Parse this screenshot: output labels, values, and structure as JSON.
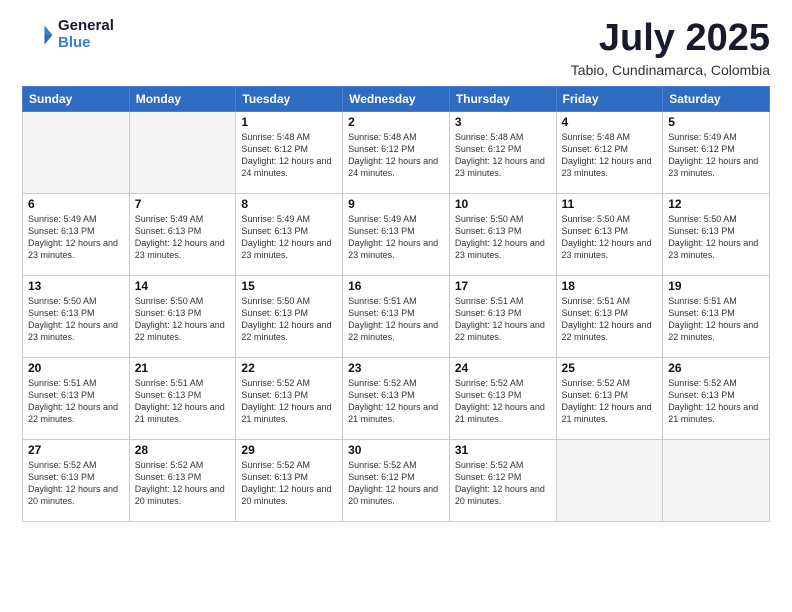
{
  "logo": {
    "general": "General",
    "blue": "Blue"
  },
  "header": {
    "month": "July 2025",
    "location": "Tabio, Cundinamarca, Colombia"
  },
  "weekdays": [
    "Sunday",
    "Monday",
    "Tuesday",
    "Wednesday",
    "Thursday",
    "Friday",
    "Saturday"
  ],
  "weeks": [
    [
      {
        "day": "",
        "info": ""
      },
      {
        "day": "",
        "info": ""
      },
      {
        "day": "1",
        "info": "Sunrise: 5:48 AM\nSunset: 6:12 PM\nDaylight: 12 hours and 24 minutes."
      },
      {
        "day": "2",
        "info": "Sunrise: 5:48 AM\nSunset: 6:12 PM\nDaylight: 12 hours and 24 minutes."
      },
      {
        "day": "3",
        "info": "Sunrise: 5:48 AM\nSunset: 6:12 PM\nDaylight: 12 hours and 23 minutes."
      },
      {
        "day": "4",
        "info": "Sunrise: 5:48 AM\nSunset: 6:12 PM\nDaylight: 12 hours and 23 minutes."
      },
      {
        "day": "5",
        "info": "Sunrise: 5:49 AM\nSunset: 6:12 PM\nDaylight: 12 hours and 23 minutes."
      }
    ],
    [
      {
        "day": "6",
        "info": "Sunrise: 5:49 AM\nSunset: 6:13 PM\nDaylight: 12 hours and 23 minutes."
      },
      {
        "day": "7",
        "info": "Sunrise: 5:49 AM\nSunset: 6:13 PM\nDaylight: 12 hours and 23 minutes."
      },
      {
        "day": "8",
        "info": "Sunrise: 5:49 AM\nSunset: 6:13 PM\nDaylight: 12 hours and 23 minutes."
      },
      {
        "day": "9",
        "info": "Sunrise: 5:49 AM\nSunset: 6:13 PM\nDaylight: 12 hours and 23 minutes."
      },
      {
        "day": "10",
        "info": "Sunrise: 5:50 AM\nSunset: 6:13 PM\nDaylight: 12 hours and 23 minutes."
      },
      {
        "day": "11",
        "info": "Sunrise: 5:50 AM\nSunset: 6:13 PM\nDaylight: 12 hours and 23 minutes."
      },
      {
        "day": "12",
        "info": "Sunrise: 5:50 AM\nSunset: 6:13 PM\nDaylight: 12 hours and 23 minutes."
      }
    ],
    [
      {
        "day": "13",
        "info": "Sunrise: 5:50 AM\nSunset: 6:13 PM\nDaylight: 12 hours and 23 minutes."
      },
      {
        "day": "14",
        "info": "Sunrise: 5:50 AM\nSunset: 6:13 PM\nDaylight: 12 hours and 22 minutes."
      },
      {
        "day": "15",
        "info": "Sunrise: 5:50 AM\nSunset: 6:13 PM\nDaylight: 12 hours and 22 minutes."
      },
      {
        "day": "16",
        "info": "Sunrise: 5:51 AM\nSunset: 6:13 PM\nDaylight: 12 hours and 22 minutes."
      },
      {
        "day": "17",
        "info": "Sunrise: 5:51 AM\nSunset: 6:13 PM\nDaylight: 12 hours and 22 minutes."
      },
      {
        "day": "18",
        "info": "Sunrise: 5:51 AM\nSunset: 6:13 PM\nDaylight: 12 hours and 22 minutes."
      },
      {
        "day": "19",
        "info": "Sunrise: 5:51 AM\nSunset: 6:13 PM\nDaylight: 12 hours and 22 minutes."
      }
    ],
    [
      {
        "day": "20",
        "info": "Sunrise: 5:51 AM\nSunset: 6:13 PM\nDaylight: 12 hours and 22 minutes."
      },
      {
        "day": "21",
        "info": "Sunrise: 5:51 AM\nSunset: 6:13 PM\nDaylight: 12 hours and 21 minutes."
      },
      {
        "day": "22",
        "info": "Sunrise: 5:52 AM\nSunset: 6:13 PM\nDaylight: 12 hours and 21 minutes."
      },
      {
        "day": "23",
        "info": "Sunrise: 5:52 AM\nSunset: 6:13 PM\nDaylight: 12 hours and 21 minutes."
      },
      {
        "day": "24",
        "info": "Sunrise: 5:52 AM\nSunset: 6:13 PM\nDaylight: 12 hours and 21 minutes."
      },
      {
        "day": "25",
        "info": "Sunrise: 5:52 AM\nSunset: 6:13 PM\nDaylight: 12 hours and 21 minutes."
      },
      {
        "day": "26",
        "info": "Sunrise: 5:52 AM\nSunset: 6:13 PM\nDaylight: 12 hours and 21 minutes."
      }
    ],
    [
      {
        "day": "27",
        "info": "Sunrise: 5:52 AM\nSunset: 6:13 PM\nDaylight: 12 hours and 20 minutes."
      },
      {
        "day": "28",
        "info": "Sunrise: 5:52 AM\nSunset: 6:13 PM\nDaylight: 12 hours and 20 minutes."
      },
      {
        "day": "29",
        "info": "Sunrise: 5:52 AM\nSunset: 6:13 PM\nDaylight: 12 hours and 20 minutes."
      },
      {
        "day": "30",
        "info": "Sunrise: 5:52 AM\nSunset: 6:12 PM\nDaylight: 12 hours and 20 minutes."
      },
      {
        "day": "31",
        "info": "Sunrise: 5:52 AM\nSunset: 6:12 PM\nDaylight: 12 hours and 20 minutes."
      },
      {
        "day": "",
        "info": ""
      },
      {
        "day": "",
        "info": ""
      }
    ]
  ]
}
